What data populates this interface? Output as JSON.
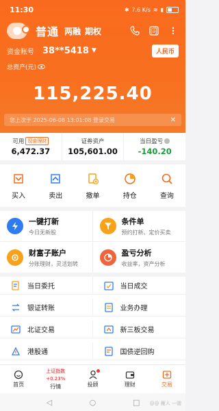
{
  "status": {
    "time": "11:30",
    "network": "7.6 K/s",
    "battery": "(battery)"
  },
  "header": {
    "account_type": "普通",
    "modes": [
      "两融",
      "期权"
    ],
    "fund_label": "资金账号",
    "fund_no": "38**5418",
    "currency": "人民币",
    "asset_label": "总资产(元)",
    "total_assets": "115,225.40",
    "last_login": "您上次于 2025-06-08 13:01:08 登录交易"
  },
  "summary": [
    {
      "label": "可用",
      "tag": "现金理财",
      "value": "6,472.37"
    },
    {
      "label": "证券资产",
      "value": "105,601.00"
    },
    {
      "label": "当日盈亏",
      "value": "-140.20"
    }
  ],
  "quick_actions": [
    {
      "label": "买入",
      "icon": "buy-icon"
    },
    {
      "label": "卖出",
      "icon": "sell-icon"
    },
    {
      "label": "撤单",
      "icon": "cancel-order-icon"
    },
    {
      "label": "持仓",
      "icon": "position-icon"
    },
    {
      "label": "查询",
      "icon": "query-icon"
    }
  ],
  "features": [
    {
      "title": "一键打新",
      "sub": "今日无新股",
      "color": "#2f7cf0"
    },
    {
      "title": "条件单",
      "sub": "预约打新、定价买卖",
      "color": "#f7a21a"
    },
    {
      "title": "财富子账户",
      "sub": "分账理财，灵活划转",
      "color": "#f7a21a"
    },
    {
      "title": "盈亏分析",
      "sub": "收益率，资产分析",
      "color": "#f0643c"
    }
  ],
  "menu": [
    {
      "label": "当日委托",
      "icon": "entrust-icon"
    },
    {
      "label": "当日成交",
      "icon": "deal-icon"
    },
    {
      "label": "银证转账",
      "icon": "transfer-icon"
    },
    {
      "label": "业务办理",
      "icon": "business-icon"
    },
    {
      "label": "北证交易",
      "icon": "bse-icon"
    },
    {
      "label": "新三板交易",
      "icon": "neeq-icon"
    },
    {
      "label": "港股通",
      "icon": "hk-connect-icon"
    },
    {
      "label": "国债逆回购",
      "icon": "repo-icon"
    }
  ],
  "nav": {
    "home": "首页",
    "index_name": "上证指数",
    "index_val": "+0.23%",
    "quotes": "行情",
    "advisor": "投顾",
    "wealth": "理财",
    "trade": "交易"
  },
  "watermark": "@@ 雁人 一骢",
  "colors": {
    "brand": "#f26a1b",
    "down": "#1a9b3a",
    "up": "#e02020"
  }
}
